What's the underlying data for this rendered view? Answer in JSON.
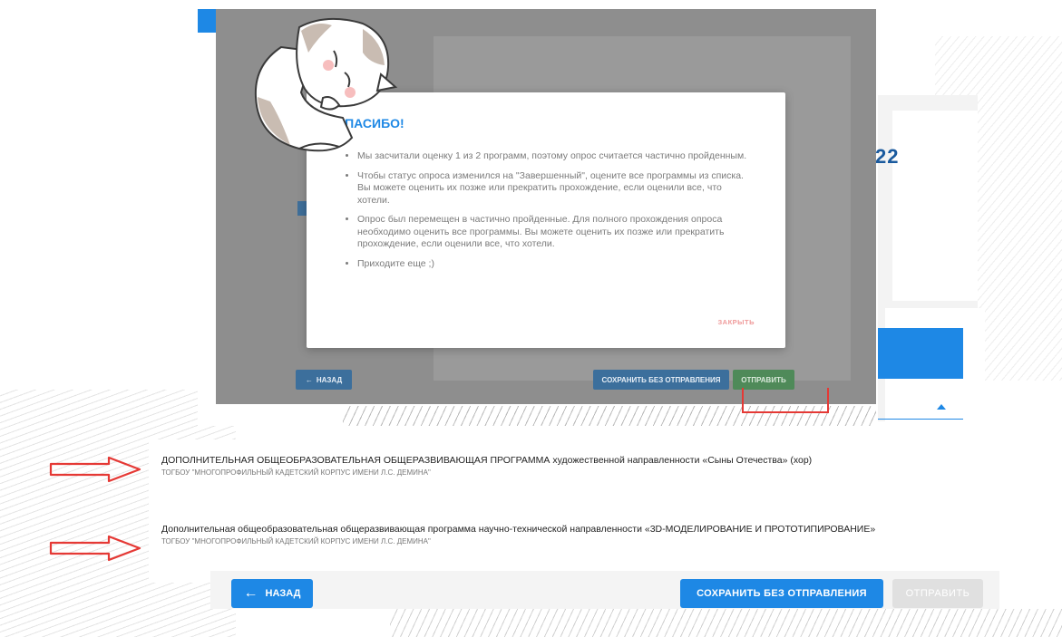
{
  "modal": {
    "title": "СПАСИБО!",
    "bullets": [
      "Мы засчитали оценку 1 из 2 программ, поэтому опрос считается частично пройденным.",
      "Чтобы статус опроса изменился на \"Завершенный\", оцените все программы из списка. Вы можете оценить их позже или прекратить прохождение, если оценили все, что хотели.",
      "Опрос был перемещен в частично пройденные. Для полного прохождения опроса необходимо оценить все программы. Вы можете оценить их позже или прекратить прохождение, если оценили все, что хотели.",
      "Приходите еще ;)"
    ],
    "close_label": "ЗАКРЫТЬ"
  },
  "inner_toolbar": {
    "back_label": "НАЗАД",
    "save_label": "СОХРАНИТЬ БЕЗ ОТПРАВЛЕНИЯ",
    "send_label": "ОТПРАВИТЬ"
  },
  "background": {
    "card_year_fragment": "22"
  },
  "programs": [
    {
      "title": "ДОПОЛНИТЕЛЬНАЯ ОБЩЕОБРАЗОВАТЕЛЬНАЯ ОБЩЕРАЗВИВАЮЩАЯ ПРОГРАММА художественной направленности «Сыны Отечества» (хор)",
      "organization": "ТОГБОУ \"МНОГОПРОФИЛЬНЫЙ КАДЕТСКИЙ КОРПУС ИМЕНИ Л.С. ДЕМИНА\""
    },
    {
      "title": "Дополнительная общеобразовательная общеразвивающая программа научно-технической направленности «3D-МОДЕЛИРОВАНИЕ И ПРОТОТИПИРОВАНИЕ»",
      "organization": "ТОГБОУ \"МНОГОПРОФИЛЬНЫЙ КАДЕТСКИЙ КОРПУС ИМЕНИ Л.С. ДЕМИНА\""
    }
  ],
  "toolbar": {
    "back_label": "НАЗАД",
    "save_label": "СОХРАНИТЬ БЕЗ ОТПРАВЛЕНИЯ",
    "send_label": "ОТПРАВИТЬ"
  },
  "colors": {
    "accent": "#1e88e5",
    "annotation_arrow": "#e53935",
    "disabled_button": "#e0e0e0",
    "close_link": "#ef9a9a"
  },
  "icons": {
    "back": "arrow-left-icon",
    "annotation": "red-outline-arrow-icon",
    "mascot": "cat-mascot-icon"
  }
}
